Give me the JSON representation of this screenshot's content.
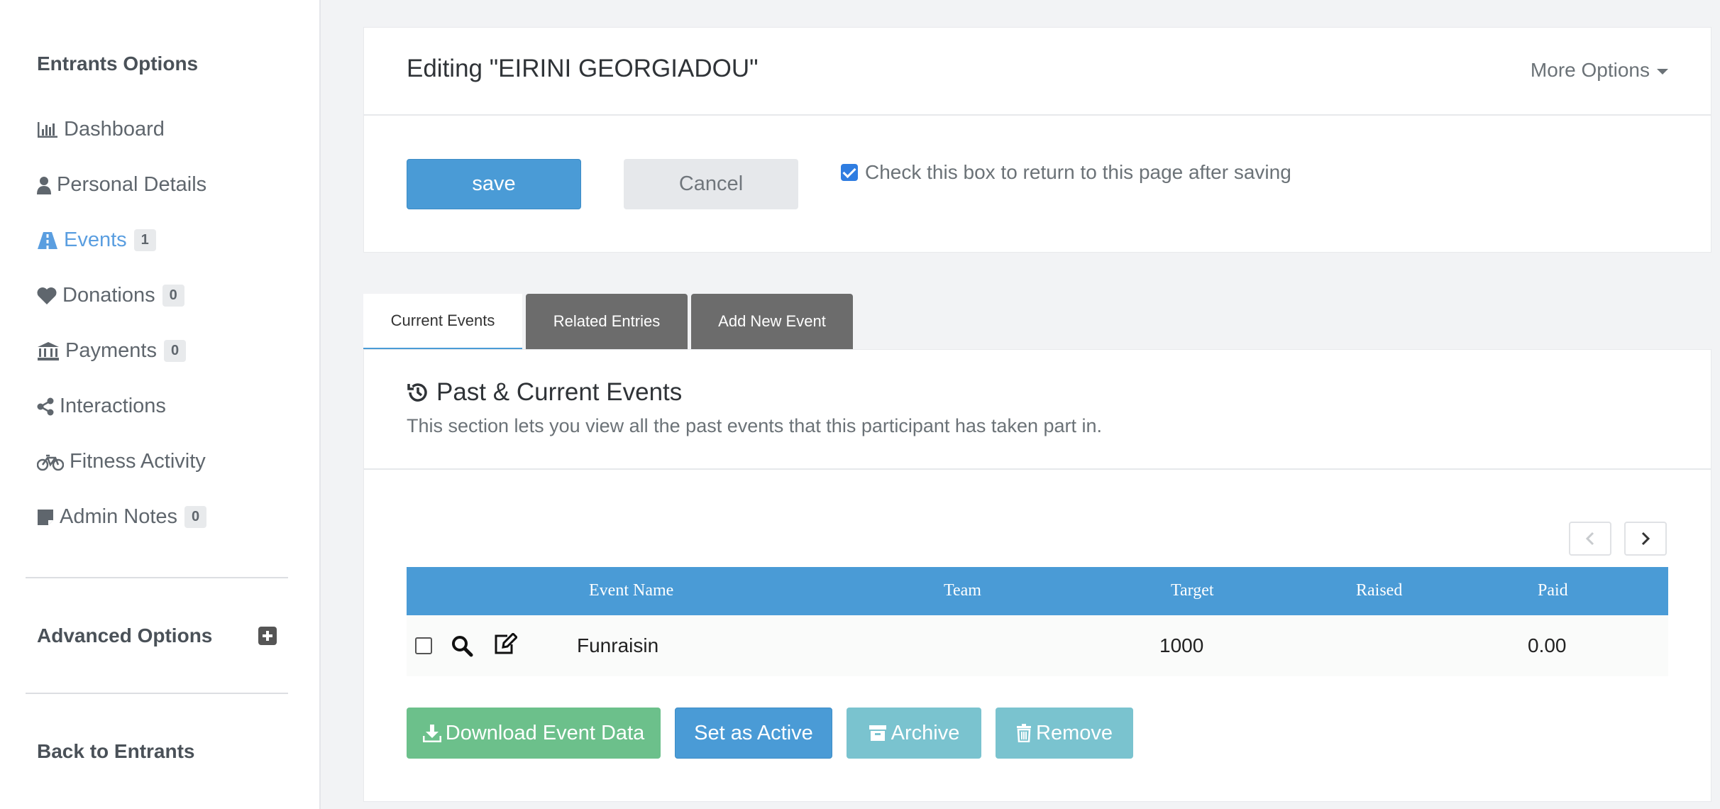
{
  "sidebar": {
    "heading": "Entrants Options",
    "items": [
      {
        "label": "Dashboard",
        "icon": "chart-icon"
      },
      {
        "label": "Personal Details",
        "icon": "user-icon"
      },
      {
        "label": "Events",
        "icon": "road-icon",
        "badge": "1",
        "active": true
      },
      {
        "label": "Donations",
        "icon": "heart-icon",
        "badge": "0"
      },
      {
        "label": "Payments",
        "icon": "bank-icon",
        "badge": "0"
      },
      {
        "label": "Interactions",
        "icon": "share-icon"
      },
      {
        "label": "Fitness Activity",
        "icon": "bicycle-icon"
      },
      {
        "label": "Admin Notes",
        "icon": "note-icon",
        "badge": "0"
      }
    ],
    "advanced_label": "Advanced Options",
    "back_label": "Back to Entrants"
  },
  "header": {
    "title": "Editing \"EIRINI GEORGIADOU\"",
    "more_options": "More Options"
  },
  "actions": {
    "save_label": "save",
    "cancel_label": "Cancel",
    "return_checkbox_label": "Check this box to return to this page after saving",
    "return_checked": true
  },
  "tabs": [
    {
      "label": "Current Events",
      "active": true
    },
    {
      "label": "Related Entries"
    },
    {
      "label": "Add New Event"
    }
  ],
  "section": {
    "title": "Past & Current Events",
    "description": "This section lets you view all the past events that this participant has taken part in."
  },
  "table": {
    "columns": [
      "Event Name",
      "Team",
      "Target",
      "Raised",
      "Paid"
    ],
    "rows": [
      {
        "event_name": "Funraisin",
        "team": "",
        "target": "1000",
        "raised": "",
        "paid": "0.00"
      }
    ]
  },
  "buttons": {
    "download": "Download Event Data",
    "set_active": "Set as Active",
    "archive": "Archive",
    "remove": "Remove"
  },
  "colors": {
    "primary": "#4a9bd6",
    "success": "#6cc08b",
    "info": "#7ac3cf",
    "tab_dark": "#6c6c6c",
    "active_link": "#5a9ee0"
  }
}
